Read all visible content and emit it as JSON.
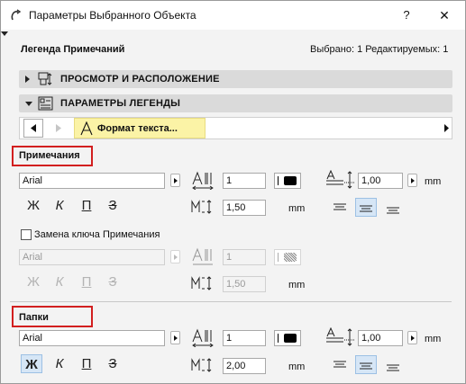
{
  "titlebar": {
    "title": "Параметры Выбранного Объекта",
    "help": "?",
    "close": "✕"
  },
  "header": {
    "left": "Легенда Примечаний",
    "right": "Выбрано: 1 Редактируемых: 1"
  },
  "panels": [
    {
      "label": "ПРОСМОТР И РАСПОЛОЖЕНИЕ",
      "expanded": false
    },
    {
      "label": "ПАРАМЕТРЫ ЛЕГЕНДЫ",
      "expanded": true
    }
  ],
  "nav": {
    "page_label": "Формат текста..."
  },
  "notes": {
    "label": "Примечания",
    "font": "Arial",
    "width_factor": "1",
    "spacing": "1,50",
    "spacing_unit": "mm",
    "size": "1,00",
    "size_unit": "mm",
    "bold": "Ж",
    "italic": "К",
    "underline": "П",
    "strike": "З"
  },
  "key_override": {
    "checked": false,
    "label": "Замена ключа Примечания",
    "font": "Arial",
    "width_factor": "1",
    "spacing": "1,50",
    "spacing_unit": "mm",
    "bold": "Ж",
    "italic": "К",
    "underline": "П",
    "strike": "З"
  },
  "folders": {
    "label": "Папки",
    "font": "Arial",
    "width_factor": "1",
    "spacing": "2,00",
    "spacing_unit": "mm",
    "size": "1,00",
    "size_unit": "mm",
    "bold": "Ж",
    "italic": "К",
    "underline": "П",
    "strike": "З"
  },
  "colors": {
    "accent_highlight": "#fbf3a6",
    "red_marker": "#d21f1f",
    "selected": "#d6e6f6"
  }
}
